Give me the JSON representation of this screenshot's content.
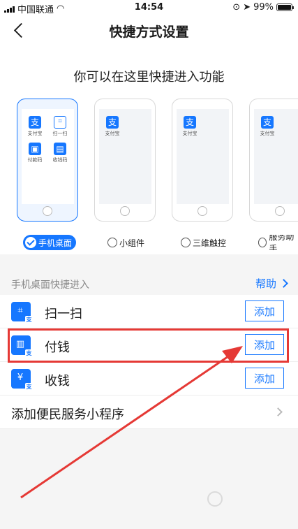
{
  "status_bar": {
    "carrier": "中国联通",
    "time": "14:54",
    "battery": "99%"
  },
  "nav": {
    "title": "快捷方式设置"
  },
  "intro": "你可以在这里快捷进入功能",
  "phone_previews": [
    {
      "apps": [
        {
          "name": "支付宝",
          "icon": "alipay-icon"
        },
        {
          "name": "扫一扫",
          "icon": "scan-icon"
        },
        {
          "name": "付款码",
          "icon": "pay-code-icon"
        },
        {
          "name": "收钱码",
          "icon": "collect-code-icon"
        }
      ]
    },
    {
      "apps": [
        {
          "name": "支付宝",
          "icon": "alipay-icon"
        }
      ]
    },
    {
      "apps": [
        {
          "name": "支付宝",
          "icon": "alipay-icon"
        }
      ]
    },
    {
      "apps": [
        {
          "name": "支付宝",
          "icon": "alipay-icon"
        }
      ]
    }
  ],
  "options": [
    {
      "label": "手机桌面",
      "selected": true
    },
    {
      "label": "小组件",
      "selected": false
    },
    {
      "label": "三维触控",
      "selected": false
    },
    {
      "label": "服务助手",
      "selected": false
    }
  ],
  "section": {
    "title": "手机桌面快捷进入",
    "help": "帮助"
  },
  "shortcuts": [
    {
      "label": "扫一扫",
      "icon": "scan-icon",
      "action": "添加"
    },
    {
      "label": "付钱",
      "icon": "pay-icon",
      "action": "添加"
    },
    {
      "label": "收钱",
      "icon": "collect-icon",
      "action": "添加"
    }
  ],
  "mini_program_link": "添加便民服务小程序",
  "colors": {
    "accent": "#1677ff",
    "annotation": "#e53935"
  }
}
